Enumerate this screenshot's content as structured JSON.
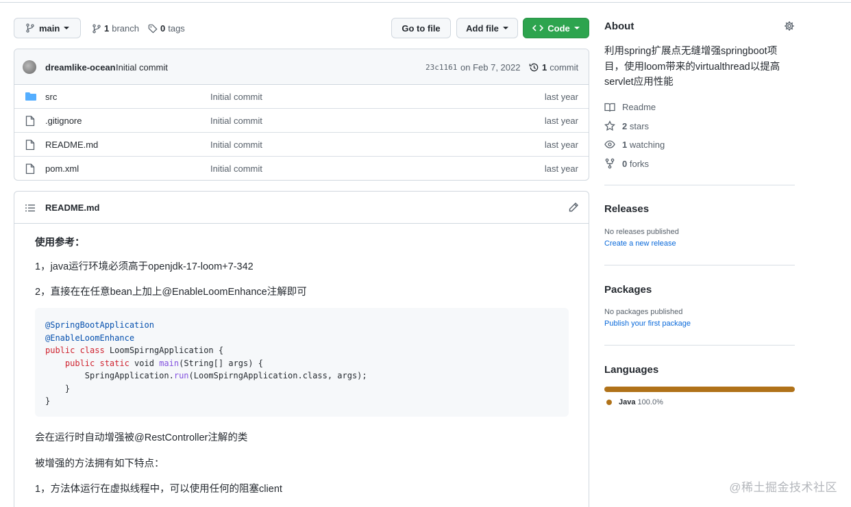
{
  "toolbar": {
    "branch_select": "main",
    "branches_count": "1",
    "branches_label": "branch",
    "tags_count": "0",
    "tags_label": "tags",
    "go_to_file": "Go to file",
    "add_file": "Add file",
    "code": "Code"
  },
  "commit": {
    "author": "dreamlike-ocean",
    "message": "Initial commit",
    "sha": "23c1161",
    "date": "on Feb 7, 2022",
    "count": "1",
    "count_label": "commit"
  },
  "files": [
    {
      "name": "src",
      "type": "folder",
      "message": "Initial commit",
      "age": "last year"
    },
    {
      "name": ".gitignore",
      "type": "file",
      "message": "Initial commit",
      "age": "last year"
    },
    {
      "name": "README.md",
      "type": "file",
      "message": "Initial commit",
      "age": "last year"
    },
    {
      "name": "pom.xml",
      "type": "file",
      "message": "Initial commit",
      "age": "last year"
    }
  ],
  "readme": {
    "title": "README.md",
    "heading": "使用参考：",
    "line1": "1，java运行环境必须高于openjdk-17-loom+7-342",
    "line2": "2，直接在在任意bean上加上@EnableLoomEnhance注解即可",
    "code": {
      "l1": "@SpringBootApplication",
      "l2": "@EnableLoomEnhance",
      "l3_kw": "public class",
      "l3_rest": " LoomSpirngApplication {",
      "l4_kw": "public static",
      "l4_type": " void ",
      "l4_fn": "main",
      "l4_rest": "(String[] args) {",
      "l5_pre": "SpringApplication.",
      "l5_fn": "run",
      "l5_rest": "(LoomSpirngApplication.class, args);",
      "l6": "}",
      "l7": "}"
    },
    "line3": "会在运行时自动增强被@RestController注解的类",
    "line4": "被增强的方法拥有如下特点：",
    "line5": "1，方法体运行在虚拟线程中，可以使用任何的阻塞client"
  },
  "sidebar": {
    "about_title": "About",
    "description": "利用spring扩展点无缝增强springboot项目，使用loom带来的virtualthread以提高servlet应用性能",
    "readme": "Readme",
    "stars_count": "2",
    "stars_label": "stars",
    "watching_count": "1",
    "watching_label": "watching",
    "forks_count": "0",
    "forks_label": "forks",
    "releases_title": "Releases",
    "releases_none": "No releases published",
    "releases_link": "Create a new release",
    "packages_title": "Packages",
    "packages_none": "No packages published",
    "packages_link": "Publish your first package",
    "languages_title": "Languages",
    "language_name": "Java",
    "language_percent": "100.0%",
    "language_color": "#b07219"
  },
  "watermark": "@稀土掘金技术社区"
}
